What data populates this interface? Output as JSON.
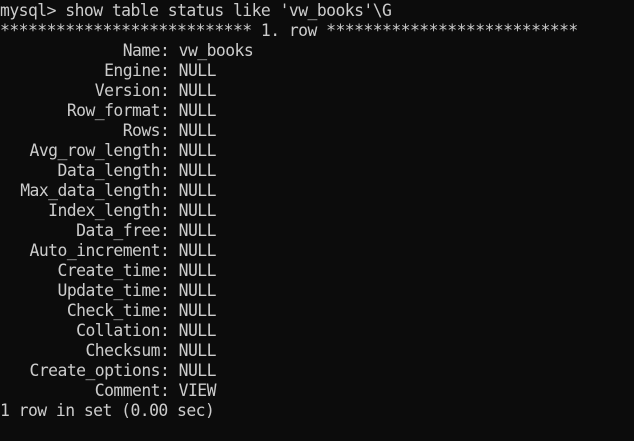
{
  "terminal": {
    "prompt": "mysql>",
    "command": "show table status like 'vw_books'\\G",
    "separator": "*************************** 1. row ***************************",
    "rows": [
      {
        "key": "Name",
        "value": "vw_books"
      },
      {
        "key": "Engine",
        "value": "NULL"
      },
      {
        "key": "Version",
        "value": "NULL"
      },
      {
        "key": "Row_format",
        "value": "NULL"
      },
      {
        "key": "Rows",
        "value": "NULL"
      },
      {
        "key": "Avg_row_length",
        "value": "NULL"
      },
      {
        "key": "Data_length",
        "value": "NULL"
      },
      {
        "key": "Max_data_length",
        "value": "NULL"
      },
      {
        "key": "Index_length",
        "value": "NULL"
      },
      {
        "key": "Data_free",
        "value": "NULL"
      },
      {
        "key": "Auto_increment",
        "value": "NULL"
      },
      {
        "key": "Create_time",
        "value": "NULL"
      },
      {
        "key": "Update_time",
        "value": "NULL"
      },
      {
        "key": "Check_time",
        "value": "NULL"
      },
      {
        "key": "Collation",
        "value": "NULL"
      },
      {
        "key": "Checksum",
        "value": "NULL"
      },
      {
        "key": "Create_options",
        "value": "NULL"
      },
      {
        "key": "Comment",
        "value": "VIEW"
      }
    ],
    "footer": "1 row in set (0.00 sec)"
  },
  "colors": {
    "background": "#0c0c0c",
    "text": "#cccccc"
  }
}
